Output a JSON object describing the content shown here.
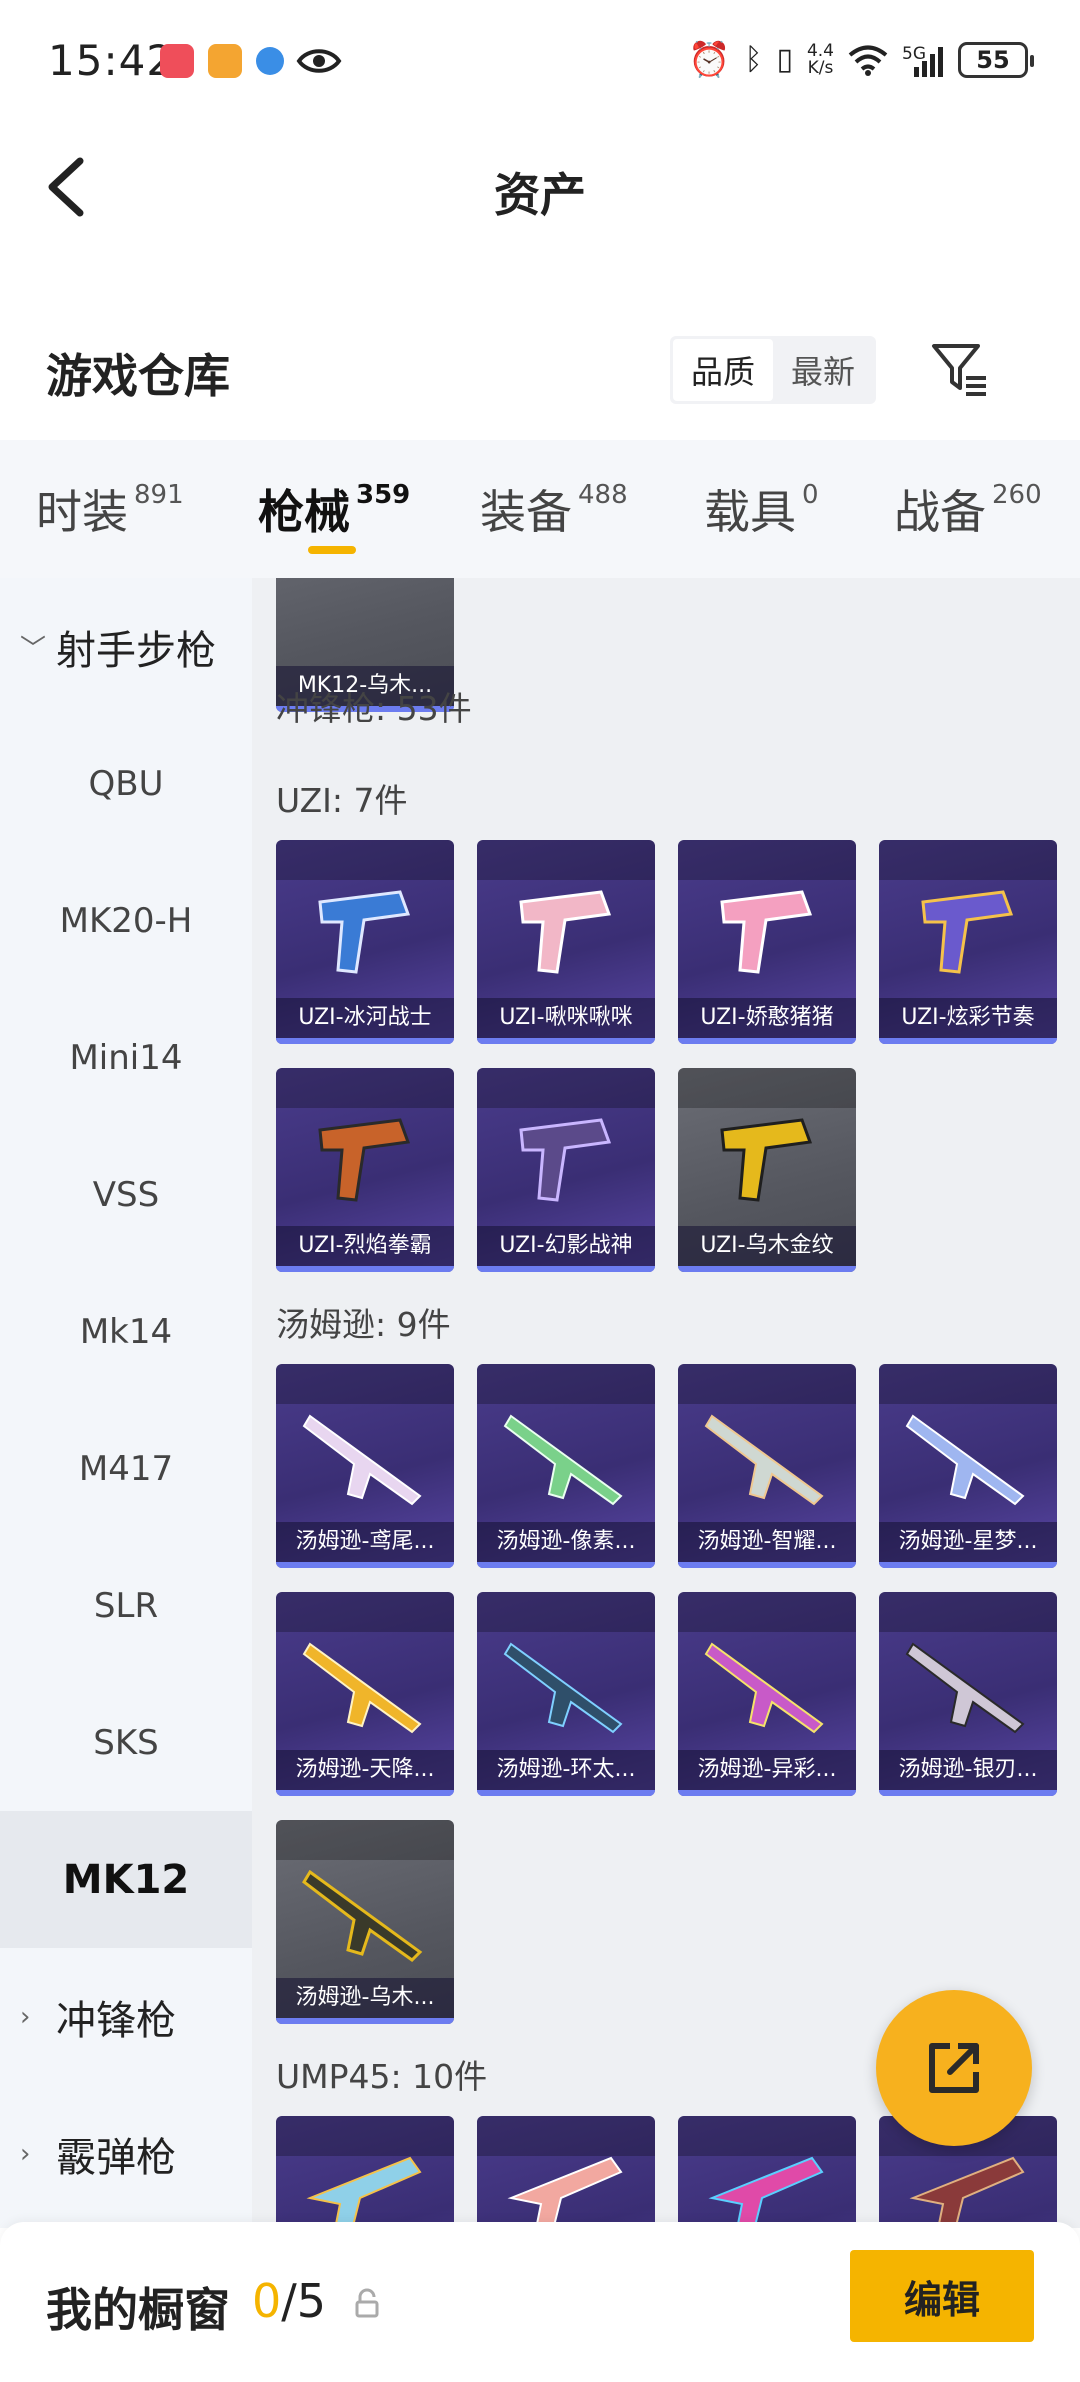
{
  "status_bar": {
    "time": "15:42",
    "net_speed_value": "4.4",
    "net_speed_unit": "K/s",
    "signal_label": "5G",
    "battery": "55"
  },
  "header": {
    "title": "资产"
  },
  "warehouse": {
    "title": "游戏仓库",
    "sort_options": [
      "品质",
      "最新"
    ],
    "selected_sort": "品质"
  },
  "tabs": [
    {
      "label": "时装",
      "count": "891"
    },
    {
      "label": "枪械",
      "count": "359"
    },
    {
      "label": "装备",
      "count": "488"
    },
    {
      "label": "载具",
      "count": "0"
    },
    {
      "label": "战备",
      "count": "260"
    }
  ],
  "active_tab": "枪械",
  "sidebar": {
    "group_sniper": "射手步枪",
    "items": [
      "QBU",
      "MK20-H",
      "Mini14",
      "VSS",
      "Mk14",
      "M417",
      "SLR",
      "SKS",
      "MK12"
    ],
    "active_item": "MK12",
    "group_smg": "冲锋枪",
    "group_shotgun": "霰弹枪"
  },
  "content": {
    "top_card": "MK12-乌木...",
    "category_smg": "冲锋枪: 53件",
    "uzi_label": "UZI: 7件",
    "uzi_items": [
      "UZI-冰河战士",
      "UZI-啾咪啾咪",
      "UZI-娇憨猪猪",
      "UZI-炫彩节奏",
      "UZI-烈焰拳霸",
      "UZI-幻影战神",
      "UZI-乌木金纹"
    ],
    "thompson_label": "汤姆逊: 9件",
    "thompson_items": [
      "汤姆逊-鸢尾...",
      "汤姆逊-像素...",
      "汤姆逊-智耀...",
      "汤姆逊-星梦...",
      "汤姆逊-天降...",
      "汤姆逊-环太...",
      "汤姆逊-异彩...",
      "汤姆逊-银刃...",
      "汤姆逊-乌木..."
    ],
    "ump_label": "UMP45: 10件"
  },
  "bottom_bar": {
    "label": "我的橱窗",
    "current": "0",
    "total": "/5",
    "edit_label": "编辑"
  },
  "colors": {
    "accent": "#f5b400",
    "card_purple": "#3a2e74",
    "card_gray": "#55575f",
    "quality_bar": "#6c7cf0"
  }
}
